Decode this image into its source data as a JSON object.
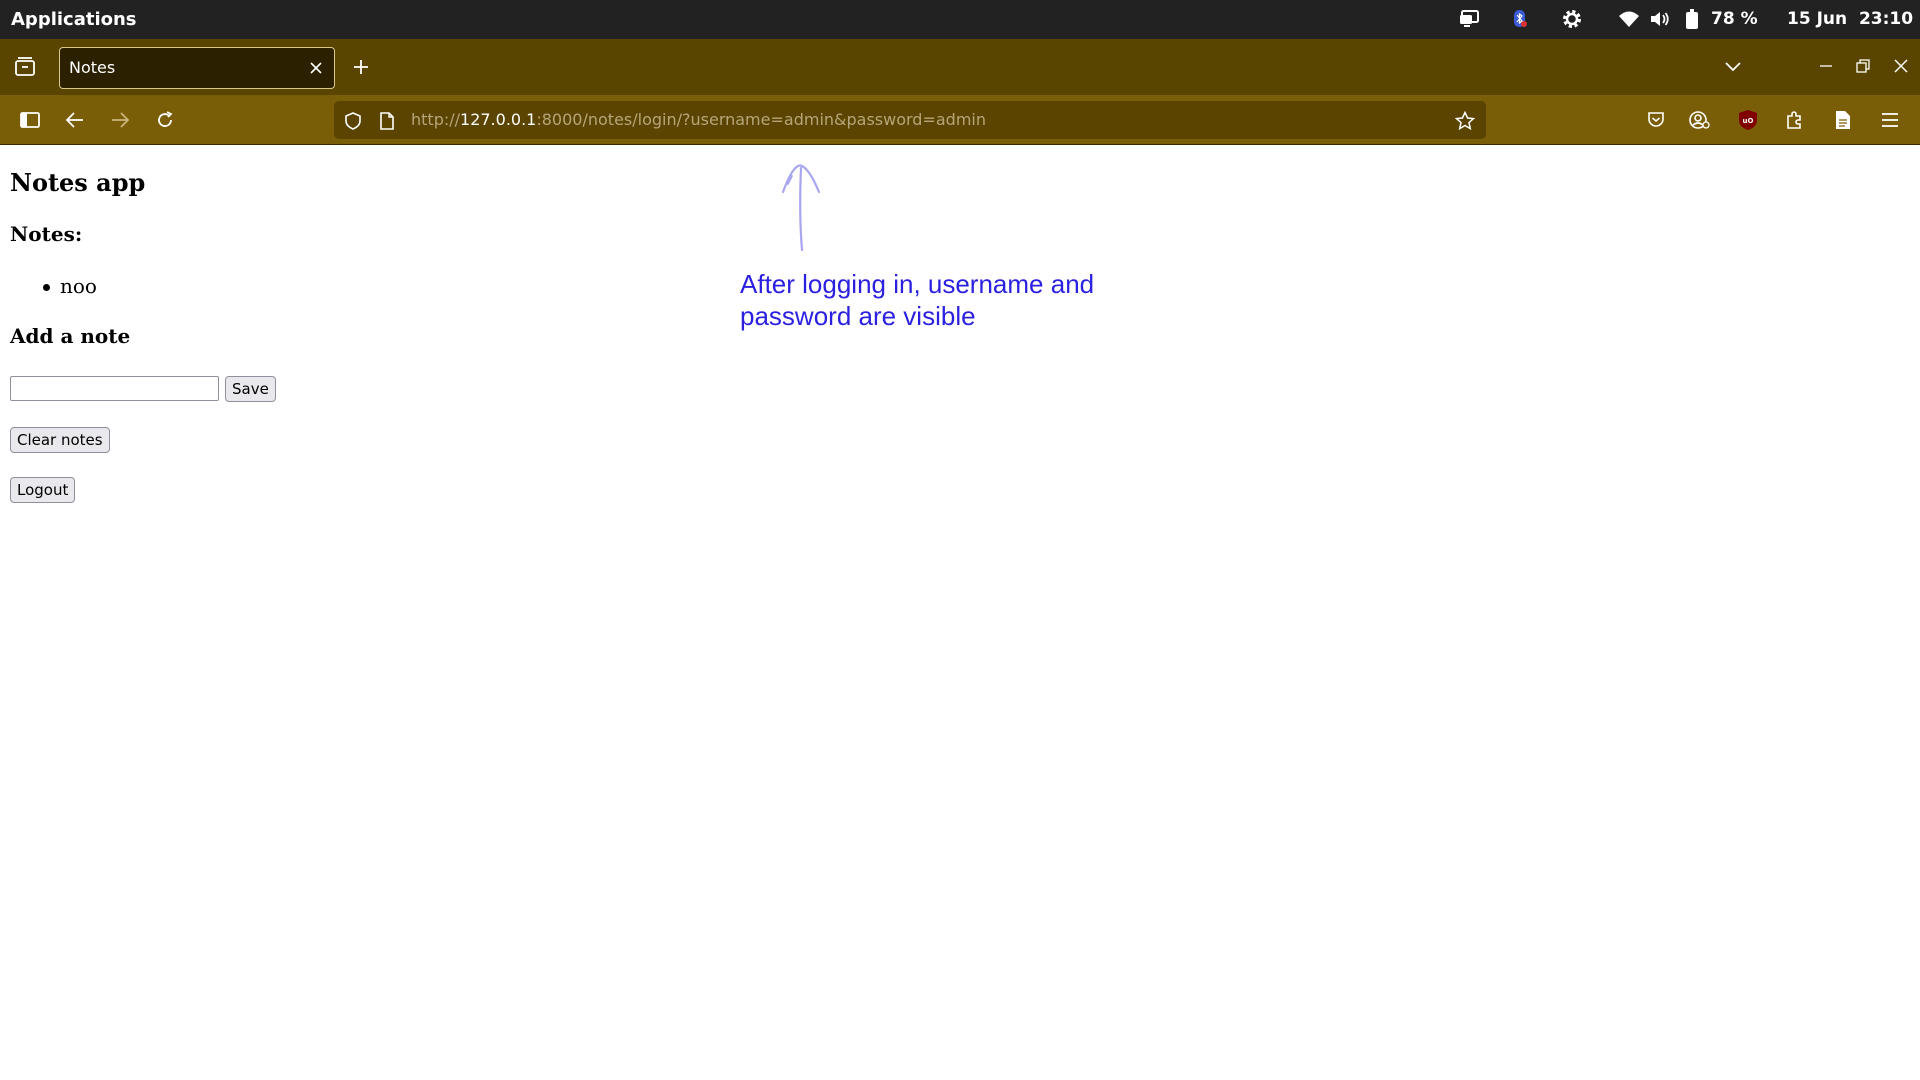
{
  "os_bar": {
    "apps_label": "Applications",
    "battery_percent": "78 %",
    "date": "15 Jun",
    "time": "23:10",
    "icons": [
      "screen-share-icon",
      "bluetooth-icon",
      "settings-gear-icon",
      "wifi-icon",
      "volume-icon",
      "battery-icon"
    ]
  },
  "browser": {
    "tab": {
      "title": "Notes"
    },
    "url": {
      "scheme": "http://",
      "host": "127.0.0.1",
      "rest": ":8000/notes/login/?username=admin&password=admin"
    },
    "colors": {
      "tab_strip": "#5a4500",
      "nav_bar": "#7a5d07",
      "urlbar": "#5a4400"
    }
  },
  "page": {
    "title": "Notes app",
    "notes_heading": "Notes:",
    "notes": [
      "noo"
    ],
    "add_heading": "Add a note",
    "input_value": "",
    "save_label": "Save",
    "clear_label": "Clear notes",
    "logout_label": "Logout"
  },
  "annotation": {
    "text": "After logging in, username and password are visible",
    "color": "#2b1fe0"
  }
}
